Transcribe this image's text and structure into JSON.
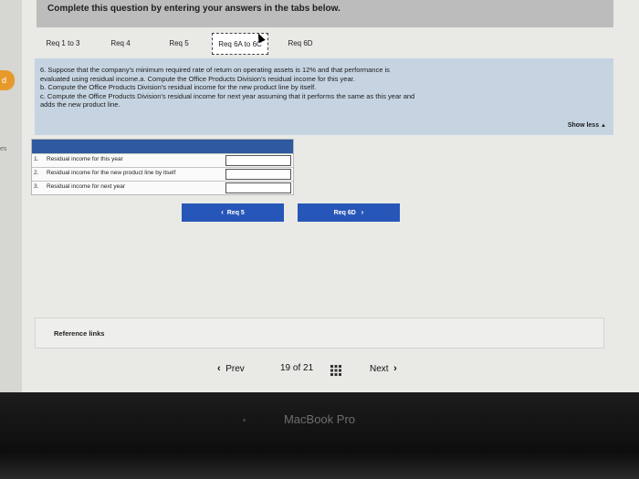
{
  "banner": {
    "instruction": "Complete this question by entering your answers in the tabs below."
  },
  "tabs": [
    {
      "label": "Req 1 to 3"
    },
    {
      "label": "Req 4"
    },
    {
      "label": "Req 5"
    },
    {
      "label": "Req 6A to 6C",
      "active": true
    },
    {
      "label": "Req 6D"
    }
  ],
  "question": {
    "lines": [
      "6. Suppose that the company's minimum required rate of return on operating assets is 12% and that performance is",
      "evaluated using residual income.a. Compute the Office Products Division's residual income for this year.",
      "b. Compute the Office Products Division's residual income for the new product line by itself.",
      "c. Compute the Office Products Division's residual income for next year assuming that it performs the same as this year and",
      "adds the new product line."
    ],
    "show_less": "Show less"
  },
  "answer_table": {
    "rows": [
      {
        "num": "1.",
        "label": "Residual income for this year",
        "value": ""
      },
      {
        "num": "2.",
        "label": "Residual income for the new product line by itself",
        "value": ""
      },
      {
        "num": "3.",
        "label": "Residual income for next year",
        "value": ""
      }
    ]
  },
  "nav": {
    "prev_label": "Req 5",
    "next_label": "Req 6D"
  },
  "reference": {
    "label": "Reference links"
  },
  "pager": {
    "prev": "Prev",
    "current": "19",
    "of": "of",
    "total": "21",
    "next": "Next"
  },
  "side": {
    "badge": "d",
    "fragment": "es"
  },
  "device": {
    "brand": "MacBook Pro"
  },
  "colors": {
    "accent": "#2656b8",
    "question_bg": "#c6d4e2",
    "badge": "#e79a2a"
  }
}
